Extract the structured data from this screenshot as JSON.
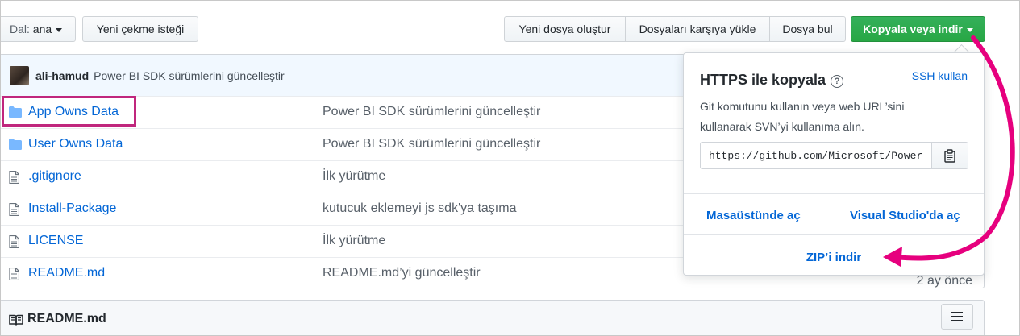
{
  "toolbar": {
    "branch_prefix": "Dal:",
    "branch_name": "ana",
    "pull_request": "Yeni çekme isteği",
    "create_file": "Yeni dosya oluştur",
    "upload_files": "Dosyaları karşıya yükle",
    "find_file": "Dosya bul",
    "clone_download": "Kopyala veya indir"
  },
  "commit": {
    "author": "ali-hamud",
    "message": "Power BI SDK sürümlerini güncelleştir"
  },
  "files": [
    {
      "name": "App Owns Data",
      "type": "folder",
      "message": "Power BI SDK sürümlerini güncelleştir",
      "age": ""
    },
    {
      "name": "User Owns Data",
      "type": "folder",
      "message": "Power BI SDK sürümlerini güncelleştir",
      "age": ""
    },
    {
      "name": ".gitignore",
      "type": "file",
      "message": "İlk yürütme",
      "age": ""
    },
    {
      "name": "Install-Package",
      "type": "file",
      "message": "kutucuk eklemeyi js sdk'ya taşıma",
      "age": ""
    },
    {
      "name": "LICENSE",
      "type": "file",
      "message": "İlk yürütme",
      "age": ""
    },
    {
      "name": "README.md",
      "type": "file",
      "message": "README.md’yi güncelleştir",
      "age": "2 ay önce"
    }
  ],
  "readme": {
    "title": "README.md"
  },
  "clone_dropdown": {
    "title": "HTTPS ile kopyala",
    "ssh_link": "SSH kullan",
    "description": "Git komutunu kullanın veya web URL’sini kullanarak SVN’yi kullanıma alın.",
    "url": "https://github.com/Microsoft/PowerBI-Developer-Samples.git",
    "open_desktop": "Masaüstünde aç",
    "open_vs": "Visual Studio'da aç",
    "download_zip": "ZIP’i indir"
  },
  "colors": {
    "accent_link": "#0366d6",
    "primary_green": "#28a745",
    "annotation_magenta": "#e6007e"
  },
  "icons": {
    "folder": "folder-icon",
    "file": "file-icon",
    "help": "help-icon",
    "clipboard": "clipboard-icon",
    "book": "book-icon",
    "list": "list-icon"
  }
}
